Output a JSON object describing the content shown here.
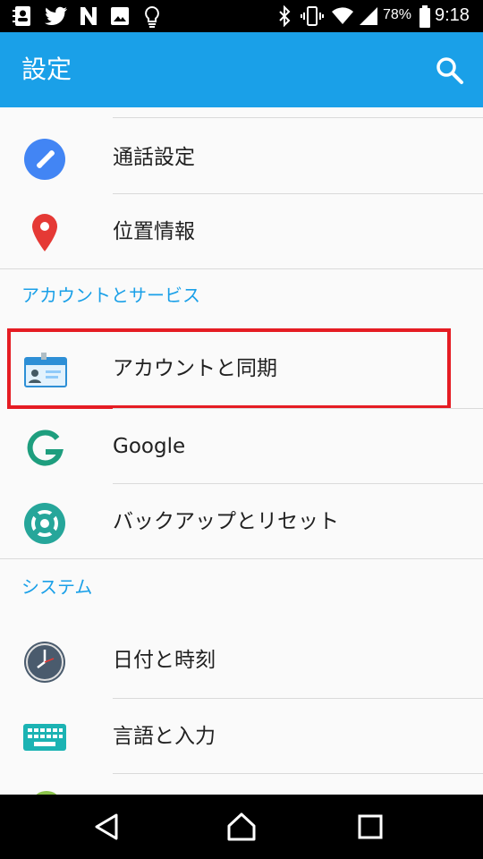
{
  "status_bar": {
    "battery": "78%",
    "time": "9:18",
    "left_icons": [
      "contacts-icon",
      "twitter-icon",
      "n-icon",
      "image-icon",
      "bulb-icon"
    ],
    "right_icons": [
      "bluetooth-icon",
      "vibrate-icon",
      "wifi-icon",
      "signal-icon",
      "battery-icon"
    ]
  },
  "app_bar": {
    "title": "設定",
    "search_icon": "search-icon"
  },
  "items": [
    {
      "label": "通話設定",
      "icon": "phone-icon",
      "color": "#4285f4"
    },
    {
      "label": "位置情報",
      "icon": "location-pin-icon",
      "color": "#e53935"
    },
    {
      "label": "アカウントと同期",
      "icon": "account-card-icon",
      "color": "#2d8fd6"
    },
    {
      "label": "Google",
      "icon": "google-g-icon",
      "color": "#1e9e7e"
    },
    {
      "label": "バックアップとリセット",
      "icon": "backup-reset-icon",
      "color": "#26a69a"
    },
    {
      "label": "日付と時刻",
      "icon": "clock-icon",
      "color": "#4a5b6d"
    },
    {
      "label": "言語と入力",
      "icon": "keyboard-icon",
      "color": "#1bb3b3"
    }
  ],
  "sections": {
    "accounts": "アカウントとサービス",
    "system": "システム"
  },
  "nav_bar": [
    "back-icon",
    "home-icon",
    "recents-icon"
  ],
  "colors": {
    "accent": "#1aa0e8",
    "highlight": "#e51c23",
    "text": "#212121"
  }
}
